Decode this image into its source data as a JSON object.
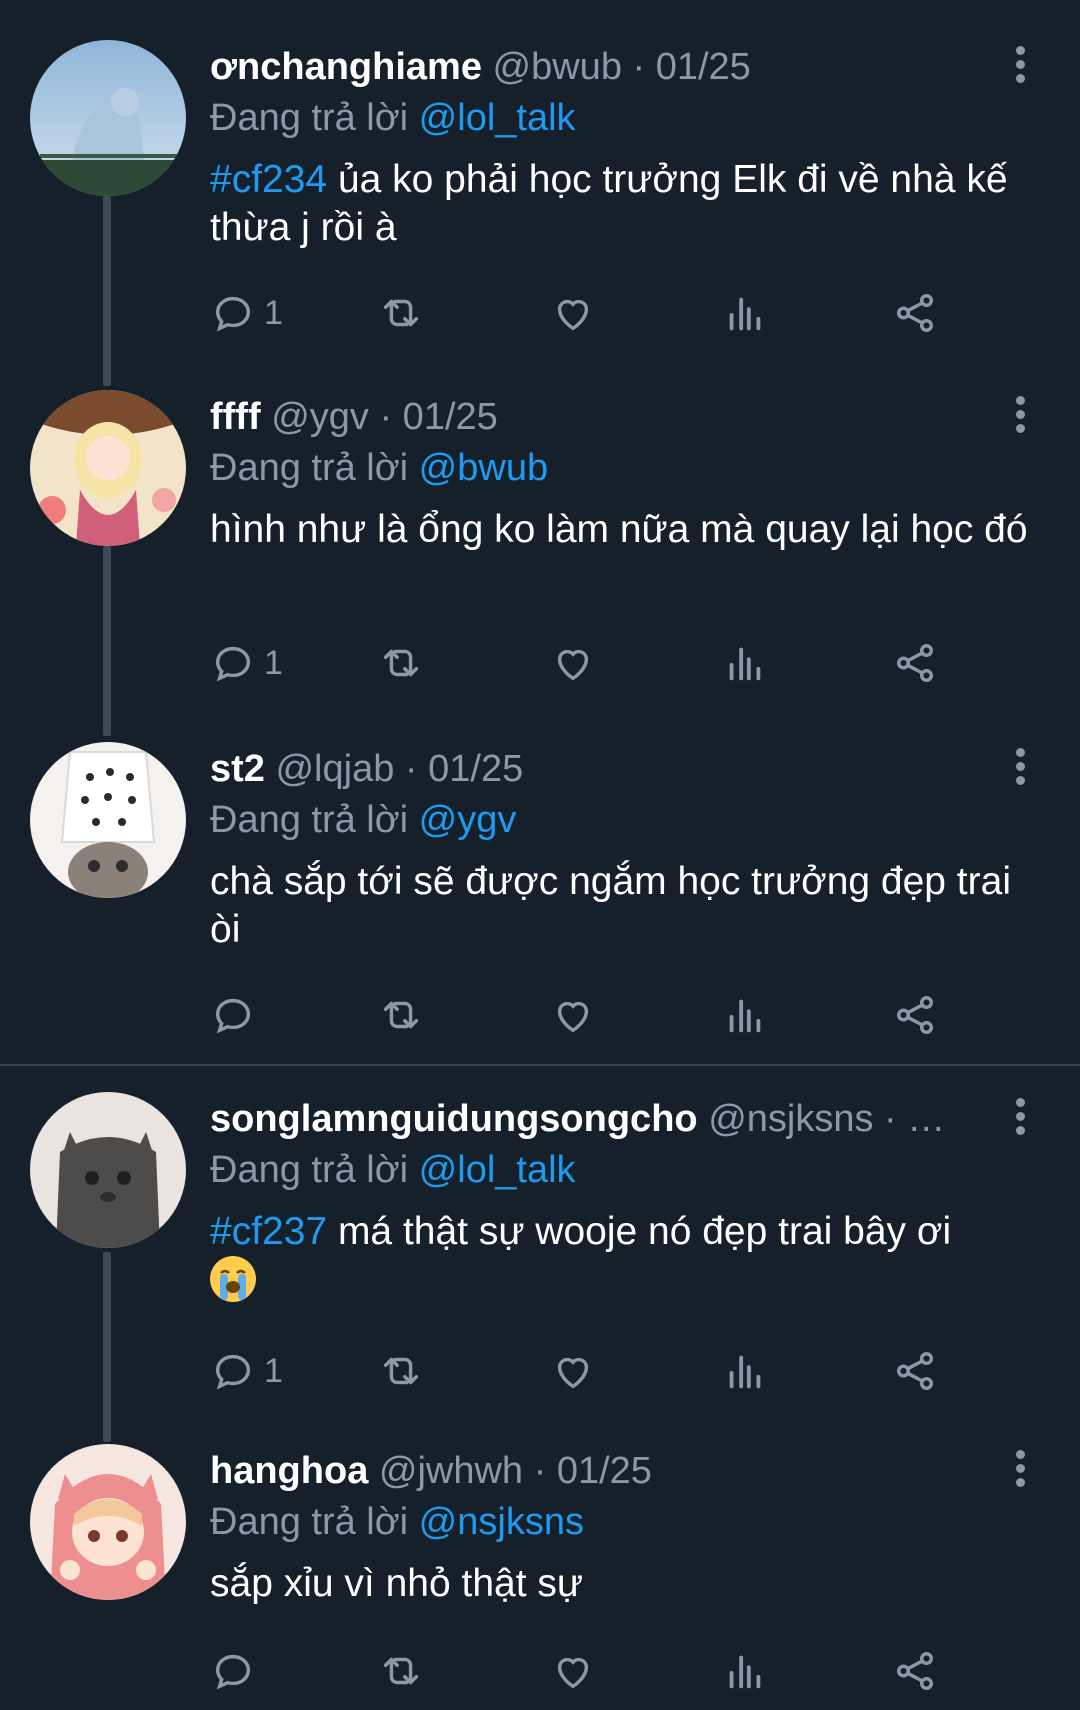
{
  "replying_label": "Đang trả lời",
  "tweets": [
    {
      "name": "ơnchanghiame",
      "handle": "@bwub",
      "date": "· 01/25",
      "reply_to": "@lol_talk",
      "hashtag": "#cf234",
      "text": " ủa ko phải học trưởng Elk đi về nhà kế thừa j rồi à",
      "reply_count": "1"
    },
    {
      "name": "ffff",
      "handle": "@ygv",
      "date": "· 01/25",
      "reply_to": "@bwub",
      "hashtag": "",
      "text": "hình như là ổng ko làm nữa mà quay lại học đó",
      "reply_count": "1"
    },
    {
      "name": "st2",
      "handle": "@lqjab",
      "date": "· 01/25",
      "reply_to": "@ygv",
      "hashtag": "",
      "text": "chà sắp tới sẽ được ngắm học trưởng đẹp trai òi",
      "reply_count": ""
    },
    {
      "name": "songlamnguidungsongcho",
      "handle": "@nsjksns",
      "date": "· …",
      "reply_to": "@lol_talk",
      "hashtag": "#cf237",
      "text": " má thật sự wooje nó đẹp trai bây ơi",
      "reply_count": "1"
    },
    {
      "name": "hanghoa",
      "handle": "@jwhwh",
      "date": "· 01/25",
      "reply_to": "@nsjksns",
      "hashtag": "",
      "text": "sắp xỉu vì nhỏ thật sự",
      "reply_count": ""
    }
  ],
  "icons": [
    "reply-icon",
    "retweet-icon",
    "like-icon",
    "views-icon",
    "share-icon",
    "more-icon"
  ],
  "colors": {
    "background": "#15202b",
    "accent": "#1d9bf0",
    "muted": "#8b98a5"
  }
}
